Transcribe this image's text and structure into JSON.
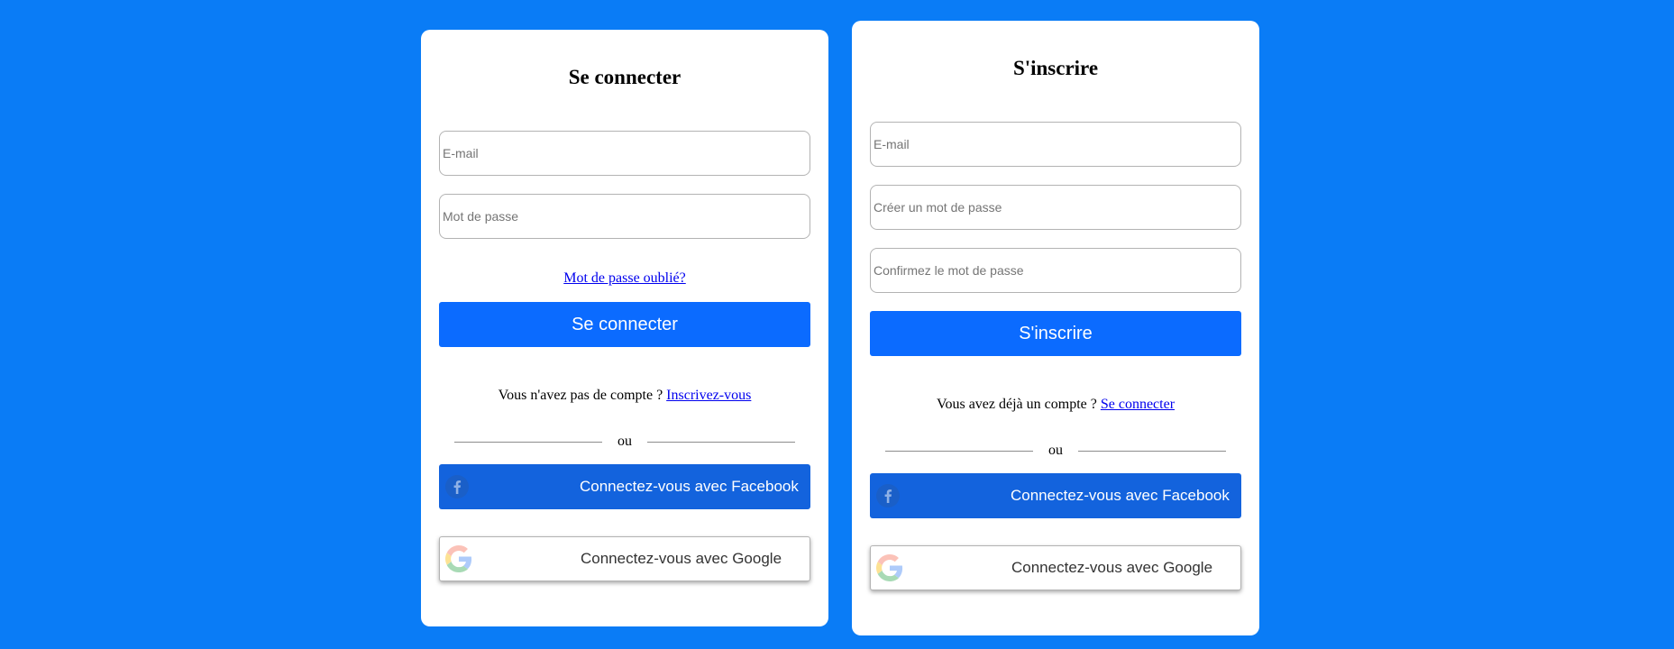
{
  "colors": {
    "background": "#0a7cf6",
    "primary_button": "#0b6bff",
    "facebook_button": "#1363dd",
    "link": "#0000ee"
  },
  "login": {
    "title": "Se connecter",
    "email_placeholder": "E-mail",
    "password_placeholder": "Mot de passe",
    "forgot_password": "Mot de passe oublié?",
    "submit_label": "Se connecter",
    "switch_prompt": "Vous n'avez pas de compte ? ",
    "switch_link": "Inscrivez-vous",
    "or_text": "ou",
    "facebook_label": "Connectez-vous avec Facebook",
    "google_label": "Connectez-vous avec Google",
    "facebook_icon": "facebook-icon",
    "google_icon": "google-icon"
  },
  "signup": {
    "title": "S'inscrire",
    "email_placeholder": "E-mail",
    "create_password_placeholder": "Créer un mot de passe",
    "confirm_password_placeholder": "Confirmez le mot de passe",
    "submit_label": "S'inscrire",
    "switch_prompt": "Vous avez déjà un compte ? ",
    "switch_link": "Se connecter",
    "or_text": "ou",
    "facebook_label": "Connectez-vous avec Facebook",
    "google_label": "Connectez-vous avec Google",
    "facebook_icon": "facebook-icon",
    "google_icon": "google-icon"
  }
}
